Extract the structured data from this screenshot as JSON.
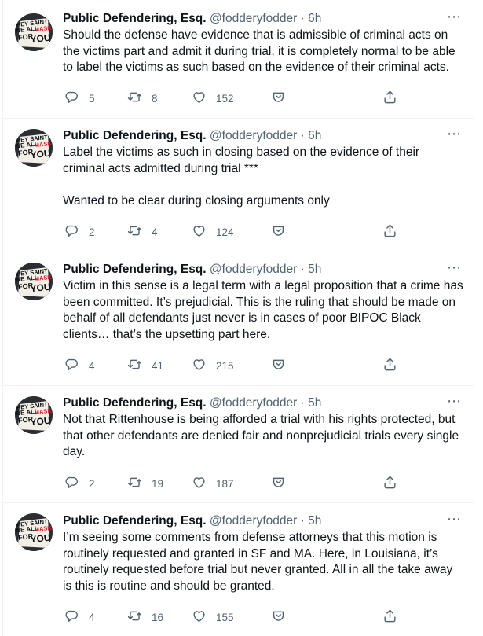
{
  "author": {
    "name": "Public Defendering, Esq.",
    "handle": "@fodderyfodder",
    "separator": "·",
    "avatar_text": [
      "HEY SAINT",
      "WE ALL",
      "MASK",
      "FOR",
      "YOU"
    ]
  },
  "icons": {
    "reply": "reply-icon",
    "retweet": "retweet-icon",
    "like": "heart-icon",
    "tip": "tip-jar-icon",
    "share": "share-icon",
    "more": "more-icon"
  },
  "colors": {
    "secondary_text": "#536471",
    "divider": "#eff3f4",
    "mask_red": "#e0202a"
  },
  "tweets": [
    {
      "time": "6h",
      "paragraphs": [
        "Should the defense have evidence that is admissible of criminal acts on the victims part and admit it during trial, it is completely normal to be able to label the victims as such based on the evidence of their criminal acts."
      ],
      "replies": "5",
      "retweets": "8",
      "likes": "152"
    },
    {
      "time": "6h",
      "paragraphs": [
        "Label the victims as such in closing based on the evidence of their criminal acts admitted during trial ***",
        "Wanted to be clear during closing arguments only"
      ],
      "replies": "2",
      "retweets": "4",
      "likes": "124"
    },
    {
      "time": "5h",
      "paragraphs": [
        "Victim in this sense is a legal term with a legal proposition that a crime has been committed. It’s prejudicial. This is the ruling that should be made on behalf of all defendants just never is in cases of poor BIPOC Black clients… that’s the upsetting part here."
      ],
      "replies": "4",
      "retweets": "41",
      "likes": "215"
    },
    {
      "time": "5h",
      "paragraphs": [
        "Not that Rittenhouse is being afforded a trial with his rights protected, but that other defendants are denied fair and nonprejudicial trials every single day."
      ],
      "replies": "2",
      "retweets": "19",
      "likes": "187"
    },
    {
      "time": "5h",
      "paragraphs": [
        "I’m seeing some comments from defense attorneys that this motion is routinely requested and granted in SF and MA. Here, in Louisiana, it’s routinely requested before trial but never granted. All in all the take away is this is routine and should be granted."
      ],
      "replies": "4",
      "retweets": "16",
      "likes": "155"
    }
  ]
}
